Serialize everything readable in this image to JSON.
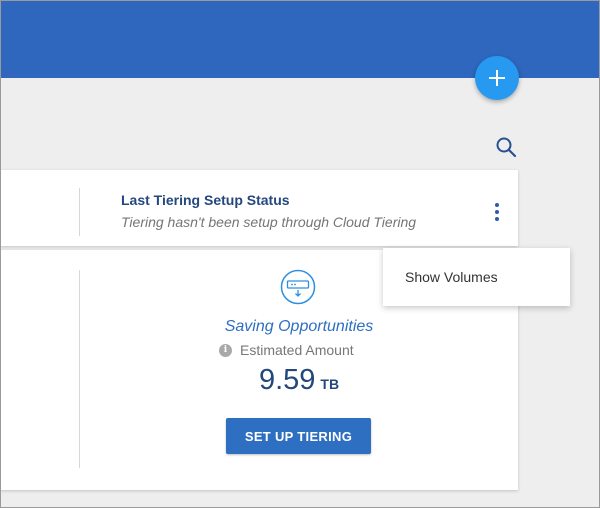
{
  "header": {
    "add_button_icon": "plus-icon",
    "search_icon": "search-icon"
  },
  "tiering_status": {
    "title": "Last Tiering Setup Status",
    "text": "Tiering hasn't been setup through Cloud Tiering",
    "menu_icon": "more-vertical-icon"
  },
  "menu": {
    "items": [
      {
        "label": "Show Volumes"
      }
    ]
  },
  "savings": {
    "icon": "tiering-storage-icon",
    "title": "Saving Opportunities",
    "info_icon": "info-icon",
    "label": "Estimated Amount",
    "value": "9.59",
    "unit": "TB",
    "button_label": "SET UP TIERING"
  },
  "colors": {
    "header_bg": "#2e67bd",
    "fab": "#2799f0",
    "primary_button": "#2e6fc2",
    "title_text": "#24477e"
  }
}
